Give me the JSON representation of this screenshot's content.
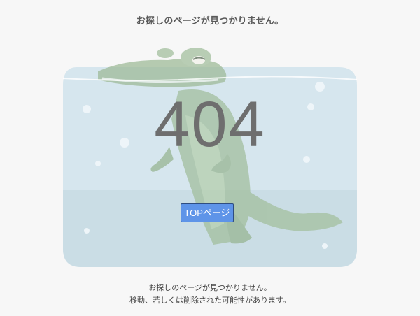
{
  "page": {
    "heading": "お探しのページが見つかりません。",
    "error_code": "404",
    "top_button_label": "TOPページ",
    "message_line1": "お探しのページが見つかりません。",
    "message_line2": "移動、若しくは削除された可能性があります。"
  },
  "illustration": {
    "subject": "crocodile-in-water",
    "colors": {
      "water": "#d6e6ee",
      "floor": "#c9dbe3",
      "croc": "#9db898",
      "croc_dark": "#86a382",
      "button": "#5e94e8"
    }
  }
}
